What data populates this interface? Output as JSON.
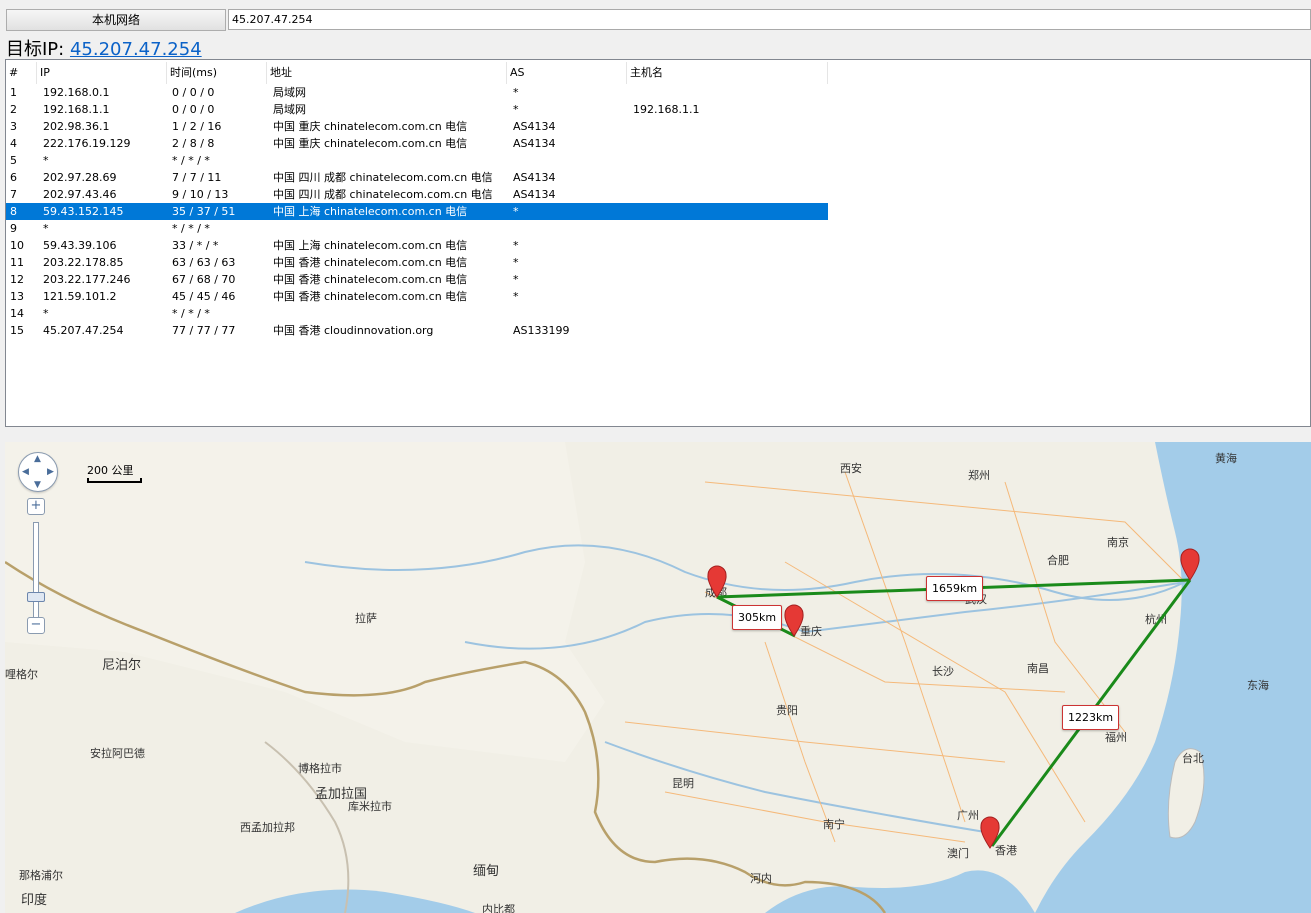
{
  "toolbar": {
    "local_network_button": "本机网络",
    "ip_input_value": "45.207.47.254"
  },
  "target": {
    "label": "目标IP:",
    "ip": "45.207.47.254"
  },
  "table": {
    "headers": [
      "#",
      "IP",
      "时间(ms)",
      "地址",
      "AS",
      "主机名"
    ],
    "selected_row": 7,
    "rows": [
      {
        "num": "1",
        "ip": "192.168.0.1",
        "time": "0 / 0 / 0",
        "addr": "局域网",
        "as": "*",
        "host": ""
      },
      {
        "num": "2",
        "ip": "192.168.1.1",
        "time": "0 / 0 / 0",
        "addr": "局域网",
        "as": "*",
        "host": "192.168.1.1"
      },
      {
        "num": "3",
        "ip": "202.98.36.1",
        "time": "1 / 2 / 16",
        "addr": "中国 重庆 chinatelecom.com.cn 电信",
        "as": "AS4134",
        "host": ""
      },
      {
        "num": "4",
        "ip": "222.176.19.129",
        "time": "2 / 8 / 8",
        "addr": "中国 重庆 chinatelecom.com.cn 电信",
        "as": "AS4134",
        "host": ""
      },
      {
        "num": "5",
        "ip": "*",
        "time": "* / * / *",
        "addr": "",
        "as": "",
        "host": ""
      },
      {
        "num": "6",
        "ip": "202.97.28.69",
        "time": "7 / 7 / 11",
        "addr": "中国 四川 成都 chinatelecom.com.cn 电信",
        "as": "AS4134",
        "host": ""
      },
      {
        "num": "7",
        "ip": "202.97.43.46",
        "time": "9 / 10 / 13",
        "addr": "中国 四川 成都 chinatelecom.com.cn 电信",
        "as": "AS4134",
        "host": ""
      },
      {
        "num": "8",
        "ip": "59.43.152.145",
        "time": "35 / 37 / 51",
        "addr": "中国 上海 chinatelecom.com.cn 电信",
        "as": "*",
        "host": ""
      },
      {
        "num": "9",
        "ip": "*",
        "time": "* / * / *",
        "addr": "",
        "as": "",
        "host": ""
      },
      {
        "num": "10",
        "ip": "59.43.39.106",
        "time": "33 / * / *",
        "addr": "中国 上海 chinatelecom.com.cn 电信",
        "as": "*",
        "host": ""
      },
      {
        "num": "11",
        "ip": "203.22.178.85",
        "time": "63 / 63 / 63",
        "addr": "中国 香港 chinatelecom.com.cn 电信",
        "as": "*",
        "host": ""
      },
      {
        "num": "12",
        "ip": "203.22.177.246",
        "time": "67 / 68 / 70",
        "addr": "中国 香港 chinatelecom.com.cn 电信",
        "as": "*",
        "host": ""
      },
      {
        "num": "13",
        "ip": "121.59.101.2",
        "time": "45 / 45 / 46",
        "addr": "中国 香港 chinatelecom.com.cn 电信",
        "as": "*",
        "host": ""
      },
      {
        "num": "14",
        "ip": "*",
        "time": "* / * / *",
        "addr": "",
        "as": "",
        "host": ""
      },
      {
        "num": "15",
        "ip": "45.207.47.254",
        "time": "77 / 77 / 77",
        "addr": "中国 香港 cloudinnovation.org",
        "as": "AS133199",
        "host": ""
      }
    ]
  },
  "map": {
    "scale_label": "200 公里",
    "zoom_in": "+",
    "zoom_out": "−",
    "distances": {
      "chengdu_shanghai": "1659km",
      "chengdu_chongqing": "305km",
      "shanghai_hongkong": "1223km"
    },
    "places": {
      "xian": "西安",
      "zhengzhou": "郑州",
      "huanghai": "黄海",
      "nanjing": "南京",
      "hefei": "合肥",
      "wuhan": "武汉",
      "hangzhou": "杭州",
      "chengdu": "成都",
      "chongqing": "重庆",
      "lhasa": "拉萨",
      "nepal": "尼泊尔",
      "changsha": "长沙",
      "nanchang": "南昌",
      "donghai": "东海",
      "guiyang": "贵阳",
      "fuzhou": "福州",
      "taibei": "台北",
      "kunming": "昆明",
      "guangzhou": "广州",
      "nanning": "南宁",
      "macau": "澳门",
      "hongkong": "香港",
      "bangladesh": "孟加拉国",
      "west_bengal": "西孟加拉邦",
      "myanmar": "缅甸",
      "hanoi": "河内",
      "india": "印度",
      "allahabad": "安拉阿巴德",
      "thimphu": "博格拉市",
      "kumila": "库米拉市",
      "pokhara": "那格浦尔",
      "gorakhpur": "哩格尔",
      "mandalay": "内比都"
    }
  }
}
